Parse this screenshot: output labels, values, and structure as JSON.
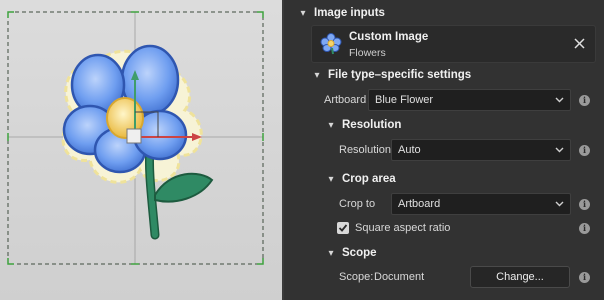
{
  "panel": {
    "image_inputs": {
      "header": "Image inputs",
      "card": {
        "title": "Custom Image",
        "subtitle": "Flowers"
      }
    },
    "file_settings": {
      "header": "File type–specific settings",
      "artboard": {
        "label": "Artboard",
        "value": "Blue Flower"
      }
    },
    "resolution": {
      "header": "Resolution",
      "label": "Resolution",
      "value": "Auto"
    },
    "crop_area": {
      "header": "Crop area",
      "label": "Crop to",
      "value": "Artboard",
      "square_label": "Square aspect ratio",
      "square_checked": true
    },
    "scope": {
      "header": "Scope",
      "label": "Scope:",
      "value": "Document",
      "change_label": "Change..."
    }
  },
  "colors": {
    "panel_bg": "#323232",
    "canvas_bg": "#d5d5d5",
    "petal": "#6f9ef0",
    "flower_center": "#f5d46a",
    "stem": "#2f8a64"
  }
}
